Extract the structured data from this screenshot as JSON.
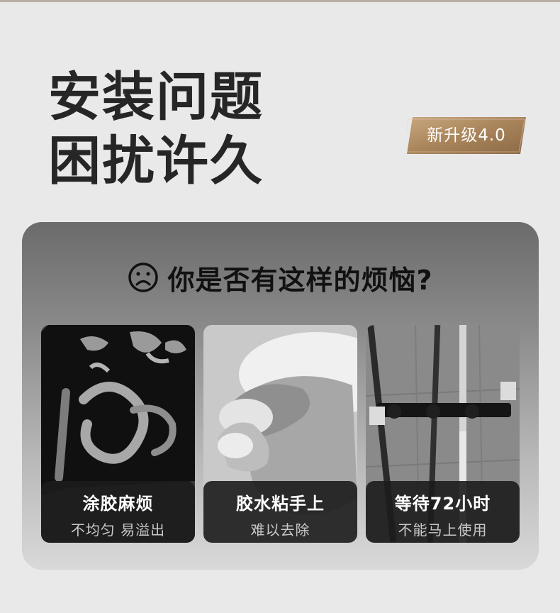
{
  "headline": {
    "line1": "安装问题",
    "line2": "困扰许久"
  },
  "badge": {
    "label": "新升级4.0"
  },
  "panel": {
    "question": "你是否有这样的烦恼?",
    "face_icon": "sad-face-icon",
    "cards": [
      {
        "title": "涂胶麻烦",
        "subtitle": "不均匀 易溢出",
        "image": "messy-glue-photo"
      },
      {
        "title": "胶水粘手上",
        "subtitle": "难以去除",
        "image": "glue-on-fingers-photo"
      },
      {
        "title": "等待72小时",
        "subtitle": "不能马上使用",
        "image": "mop-holder-rack-photo"
      }
    ]
  },
  "colors": {
    "background": "#e9e9e9",
    "badge": "#b08d66",
    "text": "#262626"
  }
}
